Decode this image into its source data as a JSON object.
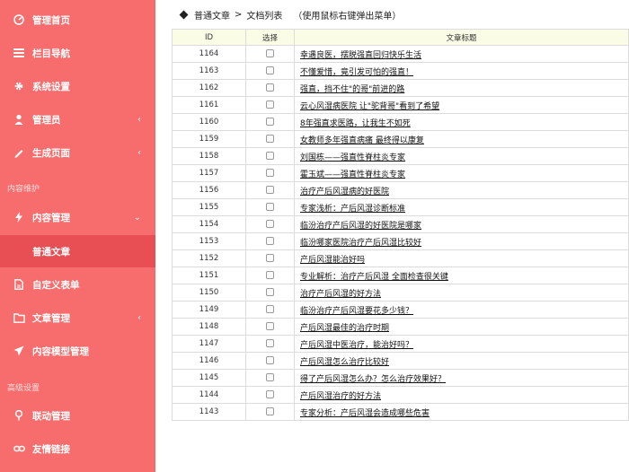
{
  "sidebar": {
    "items": [
      {
        "label": "管理首页",
        "icon": "dashboard-icon",
        "chevron": ""
      },
      {
        "label": "栏目导航",
        "icon": "list-icon",
        "chevron": ""
      },
      {
        "label": "系统设置",
        "icon": "gear-icon",
        "chevron": ""
      },
      {
        "label": "管理员",
        "icon": "user-icon",
        "chevron": "‹"
      },
      {
        "label": "生成页面",
        "icon": "pen-icon",
        "chevron": "‹"
      },
      {
        "label": "内容管理",
        "icon": "bolt-icon",
        "chevron": "⌄"
      },
      {
        "label": "普通文章",
        "icon": "",
        "chevron": ""
      },
      {
        "label": "自定义表单",
        "icon": "file-icon",
        "chevron": ""
      },
      {
        "label": "文章管理",
        "icon": "folder-icon",
        "chevron": "‹"
      },
      {
        "label": "内容模型管理",
        "icon": "send-icon",
        "chevron": ""
      },
      {
        "label": "联动管理",
        "icon": "pin-icon",
        "chevron": ""
      },
      {
        "label": "友情链接",
        "icon": "link-icon",
        "chevron": ""
      }
    ],
    "section_content": "内容维护",
    "section_advanced": "高级设置"
  },
  "breadcrumb": {
    "root": "普通文章",
    "separator": ">",
    "current": "文档列表",
    "hint": "（使用鼠标右键弹出菜单）"
  },
  "table": {
    "headers": {
      "id": "ID",
      "select": "选择",
      "title": "文章标题"
    },
    "rows": [
      {
        "id": "1164",
        "title": "幸遇良医，摆脱强直回归快乐生活"
      },
      {
        "id": "1163",
        "title": "不懂爱惜，竟引发可怕的强直！"
      },
      {
        "id": "1162",
        "title": "强直，挡不住\"的哥\"前进的路"
      },
      {
        "id": "1161",
        "title": "云心风湿病医院 让\"驼背哥\"看到了希望"
      },
      {
        "id": "1160",
        "title": "8年强直求医路，让我生不如死"
      },
      {
        "id": "1159",
        "title": "女教师多年强直病痛 最终得以康复"
      },
      {
        "id": "1158",
        "title": "刘国栋——强直性脊柱炎专家"
      },
      {
        "id": "1157",
        "title": "霍玉斌——强直性脊柱炎专家"
      },
      {
        "id": "1156",
        "title": "治疗产后风湿病的好医院"
      },
      {
        "id": "1155",
        "title": "专家浅析：产后风湿诊断标准"
      },
      {
        "id": "1154",
        "title": "临汾治疗产后风湿的好医院是哪家"
      },
      {
        "id": "1153",
        "title": "临汾哪家医院治疗产后风湿比较好"
      },
      {
        "id": "1152",
        "title": "产后风湿能治好吗"
      },
      {
        "id": "1151",
        "title": "专业解析：治疗产后风湿 全面检查很关键"
      },
      {
        "id": "1150",
        "title": "治疗产后风湿的好方法"
      },
      {
        "id": "1149",
        "title": "临汾治疗产后风湿要花多少钱？"
      },
      {
        "id": "1148",
        "title": "产后风湿最佳的治疗时期"
      },
      {
        "id": "1147",
        "title": "产后风湿中医治疗，能治好吗？"
      },
      {
        "id": "1146",
        "title": "产后风湿怎么治疗比较好"
      },
      {
        "id": "1145",
        "title": "得了产后风湿怎么办？怎么治疗效果好？"
      },
      {
        "id": "1144",
        "title": "产后风湿治疗的好方法"
      },
      {
        "id": "1143",
        "title": "专家分析：产后风湿会造成哪些危害"
      }
    ]
  },
  "colors": {
    "sidebar": "#f76d6d",
    "active": "#e84f55",
    "header_row": "#fbfce6"
  }
}
